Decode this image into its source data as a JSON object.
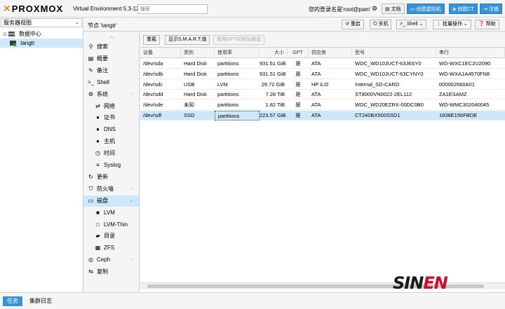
{
  "header": {
    "logo_text": "PROXMOX",
    "version": "Virtual Environment 5.3-12",
    "search_placeholder": "搜索",
    "login_text": "您的登录名是'root@pam'",
    "docs_label": "文档",
    "create_vm_label": "创建虚拟机",
    "create_ct_label": "创建CT",
    "logout_label": "注销"
  },
  "sidebar": {
    "view_label": "服务器视图",
    "datacenter": "数据中心",
    "node": "tangtr"
  },
  "node_bar": {
    "title": "节点 'tangtr'",
    "restart": "重启",
    "shutdown": "关机",
    "shell": "Shell",
    "bulk": "批量操作",
    "help": "帮助"
  },
  "nav": {
    "items": [
      {
        "label": "搜索",
        "icon": "search-icon",
        "glyph": "⚲"
      },
      {
        "label": "概要",
        "icon": "summary-icon",
        "glyph": "▤"
      },
      {
        "label": "备注",
        "icon": "notes-icon",
        "glyph": "✎"
      },
      {
        "label": "Shell",
        "icon": "terminal-icon",
        "glyph": ">_"
      },
      {
        "label": "系统",
        "icon": "cogs-icon",
        "glyph": "⚙"
      },
      {
        "label": "网络",
        "icon": "network-icon",
        "glyph": "⇄"
      },
      {
        "label": "证书",
        "icon": "certificate-icon",
        "glyph": "●"
      },
      {
        "label": "DNS",
        "icon": "globe-icon",
        "glyph": "●"
      },
      {
        "label": "主机",
        "icon": "globe-icon",
        "glyph": "●"
      },
      {
        "label": "时间",
        "icon": "clock-icon",
        "glyph": "◷"
      },
      {
        "label": "Syslog",
        "icon": "list-icon",
        "glyph": "≡"
      },
      {
        "label": "更新",
        "icon": "refresh-icon",
        "glyph": "↻"
      },
      {
        "label": "防火墙",
        "icon": "shield-icon",
        "glyph": "⛉"
      },
      {
        "label": "磁盘",
        "icon": "hdd-icon",
        "glyph": "▭"
      },
      {
        "label": "LVM",
        "icon": "square-icon",
        "glyph": "■"
      },
      {
        "label": "LVM-Thin",
        "icon": "square-outline-icon",
        "glyph": "□"
      },
      {
        "label": "目录",
        "icon": "folder-icon",
        "glyph": "▰"
      },
      {
        "label": "ZFS",
        "icon": "grid-icon",
        "glyph": "▦"
      },
      {
        "label": "Ceph",
        "icon": "ceph-icon",
        "glyph": "◎"
      },
      {
        "label": "复制",
        "icon": "retweet-icon",
        "glyph": "⇆"
      }
    ]
  },
  "toolbar": {
    "reload": "重载",
    "smart": "显示S.M.A.R.T.值",
    "gpt": "使用GPT初始化磁盘"
  },
  "grid": {
    "headers": [
      "设备",
      "类别",
      "使用率",
      "大小",
      "GPT",
      "供应商",
      "型号",
      "串行"
    ],
    "rows": [
      [
        "/dev/sda",
        "Hard Disk",
        "partitions",
        "931.51 GiB",
        "是",
        "ATA",
        "WDC_WD10JUCT-63J6SY0",
        "WD-WXC1EC2U2090"
      ],
      [
        "/dev/sdb",
        "Hard Disk",
        "partitions",
        "931.51 GiB",
        "是",
        "ATA",
        "WDC_WD10JUCT-63CYNY0",
        "WD-WXA1A4570FN8"
      ],
      [
        "/dev/sdc",
        "USB",
        "LVM",
        "29.72 GiB",
        "是",
        "HP iLO",
        "Internal_SD-CARD",
        "000002660A01"
      ],
      [
        "/dev/sdd",
        "Hard Disk",
        "partitions",
        "7.28 TiB",
        "是",
        "ATA",
        "ST8000VN0022-2EL112",
        "ZA1ESAMZ"
      ],
      [
        "/dev/sde",
        "未知",
        "partitions",
        "1.82 TiB",
        "是",
        "ATA",
        "WDC_WD20EZRX-00DC0B0",
        "WD-WMC302040045"
      ],
      [
        "/dev/sdf",
        "SSD",
        "partitions",
        "223.57 GiB",
        "是",
        "ATA",
        "CT240BX500SSD1",
        "1838E156FBDE"
      ]
    ]
  },
  "bottom": {
    "tasks": "任务",
    "cluster_log": "集群日志"
  },
  "watermark": {
    "text_a": "SIN",
    "text_b": "EN"
  }
}
